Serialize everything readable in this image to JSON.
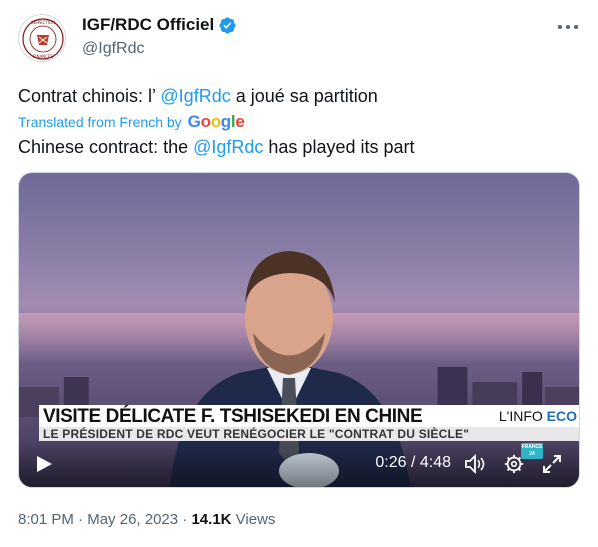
{
  "account": {
    "display_name": "IGF/RDC Officiel",
    "handle": "@IgfRdc",
    "avatar_icon": "igf-seal-logo",
    "avatar_logo_text": "INSPECTION GÉNÉRALE DES FINANCES",
    "verified_icon": "verified-badge-icon",
    "verified_color": "#1d9bf0"
  },
  "tweet": {
    "original_prefix": "Contrat chinois: l’ ",
    "original_mention": "@IgfRdc",
    "original_suffix": " a joué sa partition",
    "translated_label": "Translated from French by",
    "translator": "Google",
    "translation_prefix": "Chinese contract: the ",
    "translation_mention": "@IgfRdc",
    "translation_suffix": " has played its part"
  },
  "video": {
    "banner_title": "VISITE DÉLICATE F. TSHISEKEDI EN CHINE",
    "banner_tag_prefix": "L'INFO ",
    "banner_tag_accent": "ECO",
    "banner_subtitle": "LE PRÉSIDENT DE RDC VEUT RENÉGOCIER LE \"CONTRAT DU SIÈCLE\"",
    "watermark": "FRANCE 24",
    "time_display": "0:26 / 4:48",
    "current_time": "0:26",
    "duration": "4:48"
  },
  "meta": {
    "time": "8:01 PM",
    "separator": "·",
    "date": "May 26, 2023",
    "views_count": "14.1K",
    "views_label": "Views"
  },
  "colors": {
    "accent": "#1d9bf0",
    "text": "#0f1419",
    "secondary": "#536471"
  }
}
